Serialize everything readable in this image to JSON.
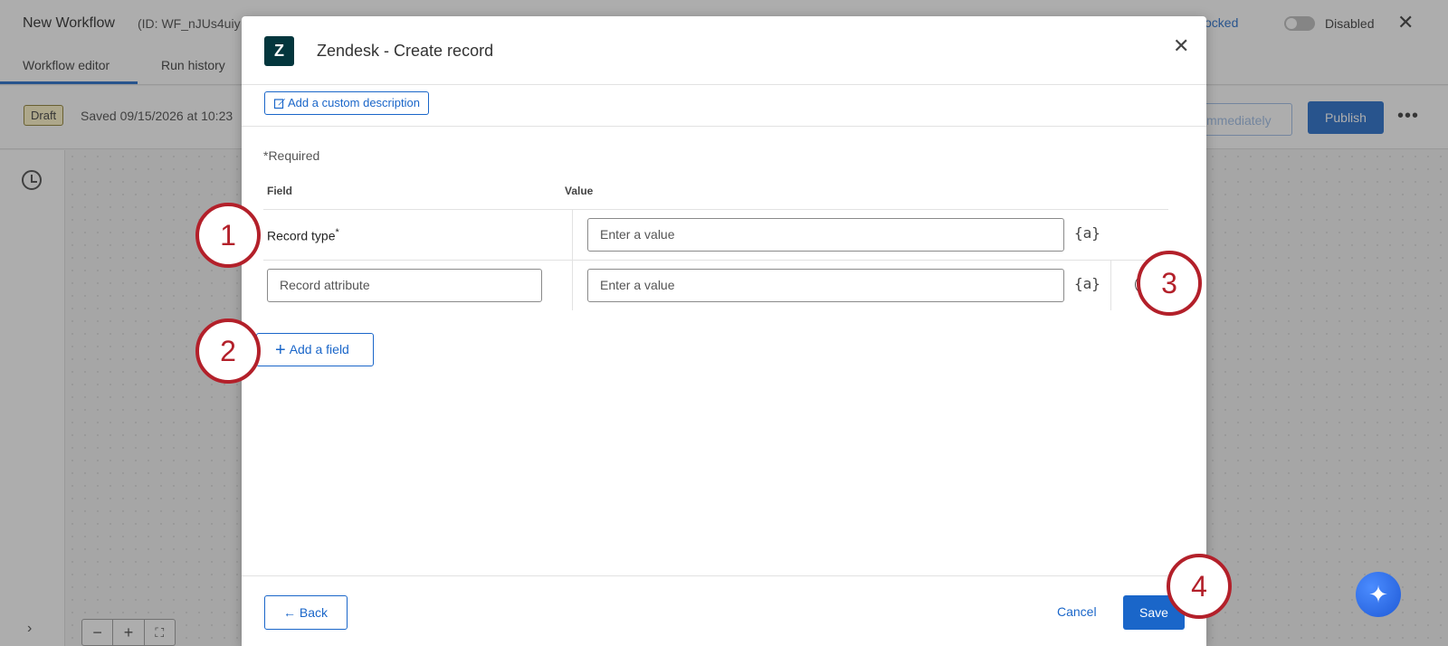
{
  "app": {
    "workflow_title": "New Workflow",
    "workflow_id": "(ID: WF_nJUs4uiy",
    "lock_status": "Unlocked",
    "toggle_label": "Disabled",
    "close_glyph": "✕"
  },
  "tabs": [
    {
      "label": "Workflow editor"
    },
    {
      "label": "Run history"
    }
  ],
  "status": {
    "badge": "Draft",
    "saved_text": "Saved 09/15/2026 at 10:23",
    "schedule_button": "mmediately",
    "publish_button": "Publish",
    "more_glyph": "•••"
  },
  "canvas": {
    "zoom_out": "−",
    "zoom_in": "+",
    "fit": "⛶",
    "expand": "›"
  },
  "modal": {
    "title": "Zendesk - Create record",
    "logo_text": "Z",
    "close_glyph": "✕",
    "custom_description_button": "Add a custom description",
    "required_note": "*Required",
    "columns": {
      "field": "Field",
      "value": "Value"
    },
    "rows": [
      {
        "field_label": "Record type",
        "required_mark": "*",
        "value_placeholder": "Enter a value",
        "piped_text_icon": "{a}"
      },
      {
        "field_placeholder": "Record attribute",
        "value_placeholder": "Enter a value",
        "piped_text_icon": "{a}"
      }
    ],
    "add_field_button": "Add a field",
    "footer": {
      "back_button": "Back",
      "cancel_button": "Cancel",
      "save_button": "Save"
    }
  },
  "callouts": [
    "1",
    "2",
    "3",
    "4"
  ],
  "colors": {
    "accent": "#1a66c9",
    "callout": "#b3202a",
    "zendesk_logo": "#03363d"
  },
  "icons": {
    "history": "history-icon",
    "pencil": "pencil-icon",
    "plus": "plus-icon",
    "arrow_left": "arrow-left-icon",
    "minus_circle": "minus-circle-icon",
    "ai": "sparkle-icon"
  }
}
